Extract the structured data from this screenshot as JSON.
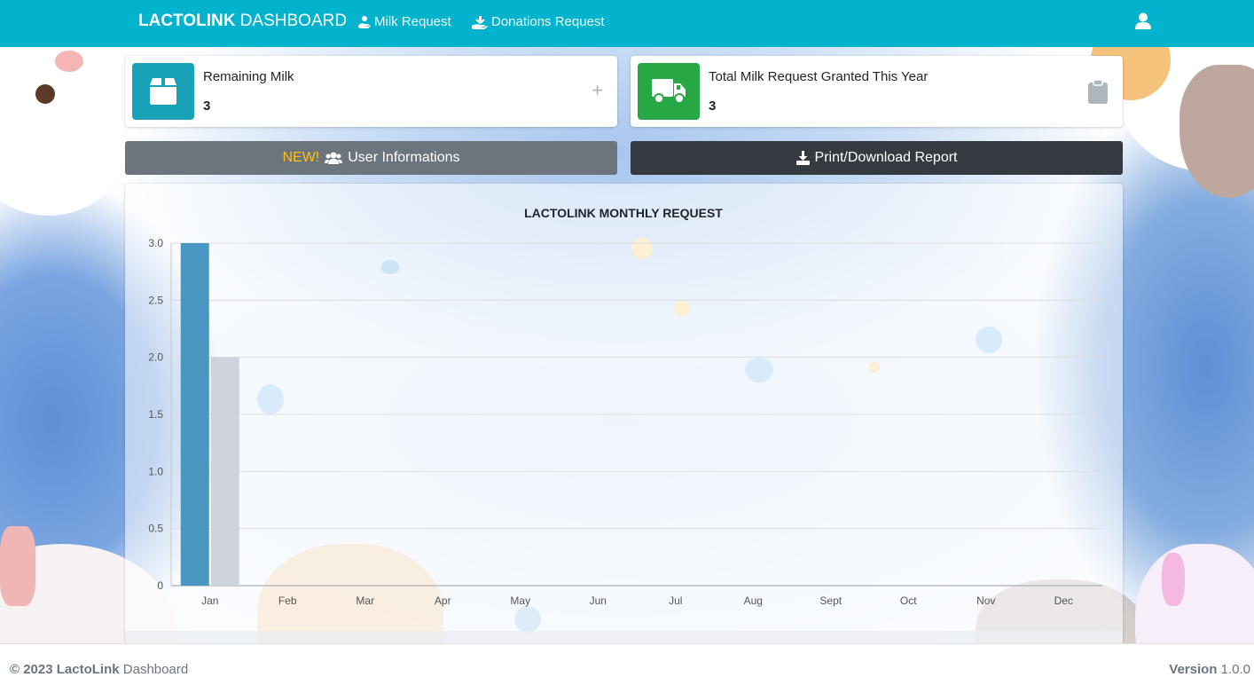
{
  "navbar": {
    "brand_bold": "LACTOLINK",
    "brand_rest": " DASHBOARD",
    "links": [
      {
        "label": "Milk Request",
        "icon": "hand-holding-icon"
      },
      {
        "label": "Donations Request",
        "icon": "hand-donate-icon"
      }
    ],
    "user_icon": "user-icon",
    "color": "#03b3cd"
  },
  "cards": {
    "remaining": {
      "label": "Remaining Milk",
      "value": "3",
      "icon": "box-icon",
      "action": "+",
      "color": "#17a2b8"
    },
    "granted": {
      "label": "Total Milk Request Granted This Year",
      "value": "3",
      "icon": "truck-icon",
      "action_icon": "clipboard-icon",
      "color": "#28a745"
    }
  },
  "buttons": {
    "user_info": {
      "badge": "NEW!",
      "label": "User Informations",
      "icon": "users-icon",
      "color": "#6c757d",
      "badge_color": "#ffc107"
    },
    "report": {
      "label": "Print/Download Report",
      "icon": "download-icon",
      "color": "#343a40"
    }
  },
  "chart_data": {
    "type": "bar",
    "title": "LACTOLINK MONTHLY REQUEST",
    "categories": [
      "Jan",
      "Feb",
      "Mar",
      "Apr",
      "May",
      "Jun",
      "Jul",
      "Aug",
      "Sept",
      "Oct",
      "Nov",
      "Dec"
    ],
    "series": [
      {
        "values": [
          3,
          0,
          0,
          0,
          0,
          0,
          0,
          0,
          0,
          0,
          0,
          0
        ],
        "color": "#4a96c2"
      },
      {
        "values": [
          2,
          0,
          0,
          0,
          0,
          0,
          0,
          0,
          0,
          0,
          0,
          0
        ],
        "color": "#cfd3db"
      }
    ],
    "yticks": [
      "0",
      "0.5",
      "1.0",
      "1.5",
      "2.0",
      "2.5",
      "3.0"
    ],
    "ylim": [
      0,
      3
    ],
    "grid": true
  },
  "footer": {
    "copyright": "© 2023 LactoLink",
    "copyright_rest": " Dashboard",
    "version_label": "Version",
    "version": " 1.0.0"
  }
}
